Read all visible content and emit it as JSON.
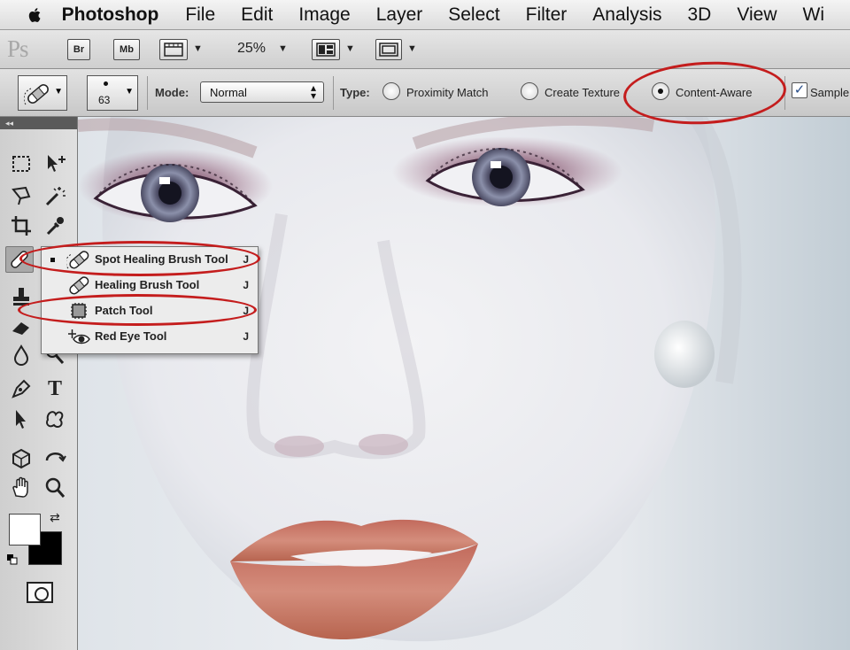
{
  "menubar": {
    "app_name": "Photoshop",
    "items": [
      "File",
      "Edit",
      "Image",
      "Layer",
      "Select",
      "Filter",
      "Analysis",
      "3D",
      "View",
      "Wi"
    ]
  },
  "appbar": {
    "logo": "Ps",
    "bridge_label": "Br",
    "minibridge_label": "Mb",
    "zoom": "25%"
  },
  "options": {
    "brush_size": "63",
    "mode_label": "Mode:",
    "mode_value": "Normal",
    "type_label": "Type:",
    "proximity_label": "Proximity Match",
    "texture_label": "Create Texture",
    "content_aware_label": "Content-Aware",
    "sample_label": "Sample All Layers"
  },
  "tools_panel": {
    "collapse_glyph": "◂◂",
    "type_tool_glyph": "T"
  },
  "flyout": {
    "items": [
      {
        "label": "Spot Healing Brush Tool",
        "key": "J",
        "icon": "spot-healing-brush-icon"
      },
      {
        "label": "Healing Brush Tool",
        "key": "J",
        "icon": "healing-brush-icon"
      },
      {
        "label": "Patch Tool",
        "key": "J",
        "icon": "patch-icon"
      },
      {
        "label": "Red Eye Tool",
        "key": "J",
        "icon": "red-eye-icon"
      }
    ]
  },
  "colors": {
    "callout": "#c41d1d",
    "lips": "#c77665",
    "eyeshadow": "#6e2f4c"
  }
}
